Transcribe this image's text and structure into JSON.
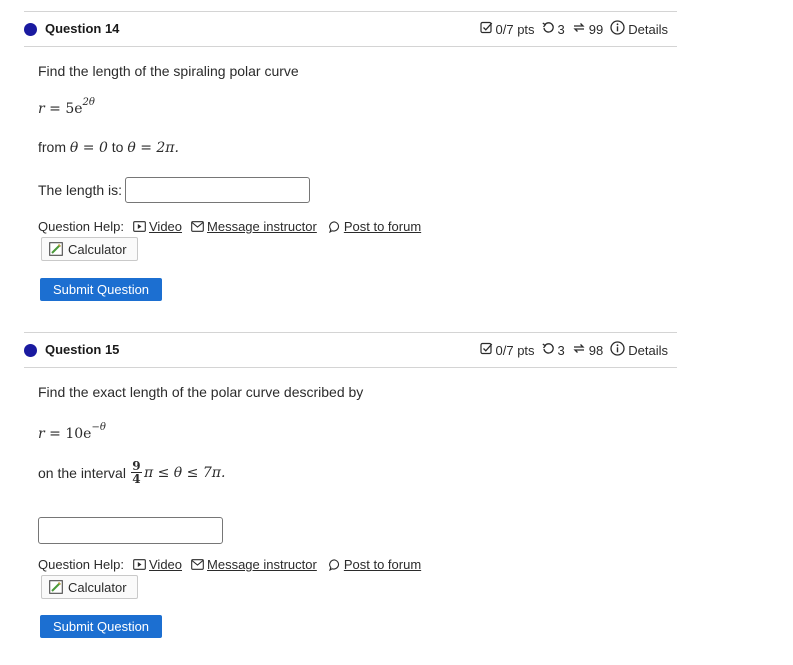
{
  "questions": [
    {
      "title": "Question 14",
      "pts": "0/7 pts",
      "attempts": "3",
      "retries": "99",
      "details": "Details",
      "prompt": "Find the length of the spiraling polar curve",
      "eq_lhs": "r",
      "eq_rhs_base": "5e",
      "eq_rhs_exp": "2θ",
      "range_from": "from",
      "theta_start": "θ = 0",
      "range_to": "to",
      "theta_end": "θ = 2π.",
      "answer_label": "The length is:",
      "answer_value": "",
      "help_label": "Question Help:",
      "help_video": "Video",
      "help_message": "Message instructor",
      "help_forum": "Post to forum",
      "calculator": "Calculator",
      "submit": "Submit Question"
    },
    {
      "title": "Question 15",
      "pts": "0/7 pts",
      "attempts": "3",
      "retries": "98",
      "details": "Details",
      "prompt": "Find the exact length of the polar curve described by",
      "eq_lhs": "r",
      "eq_rhs_base": "10e",
      "eq_rhs_exp": "−θ",
      "interval_label": "on the interval",
      "frac_num": "9",
      "frac_den": "4",
      "interval_rest": "π ≤ θ ≤ 7π.",
      "answer_value": "",
      "help_label": "Question Help:",
      "help_video": "Video",
      "help_message": "Message instructor",
      "help_forum": "Post to forum",
      "calculator": "Calculator",
      "submit": "Submit Question"
    }
  ],
  "colors": {
    "dot": "#1a1aa0",
    "submit": "#1c6fd1"
  }
}
